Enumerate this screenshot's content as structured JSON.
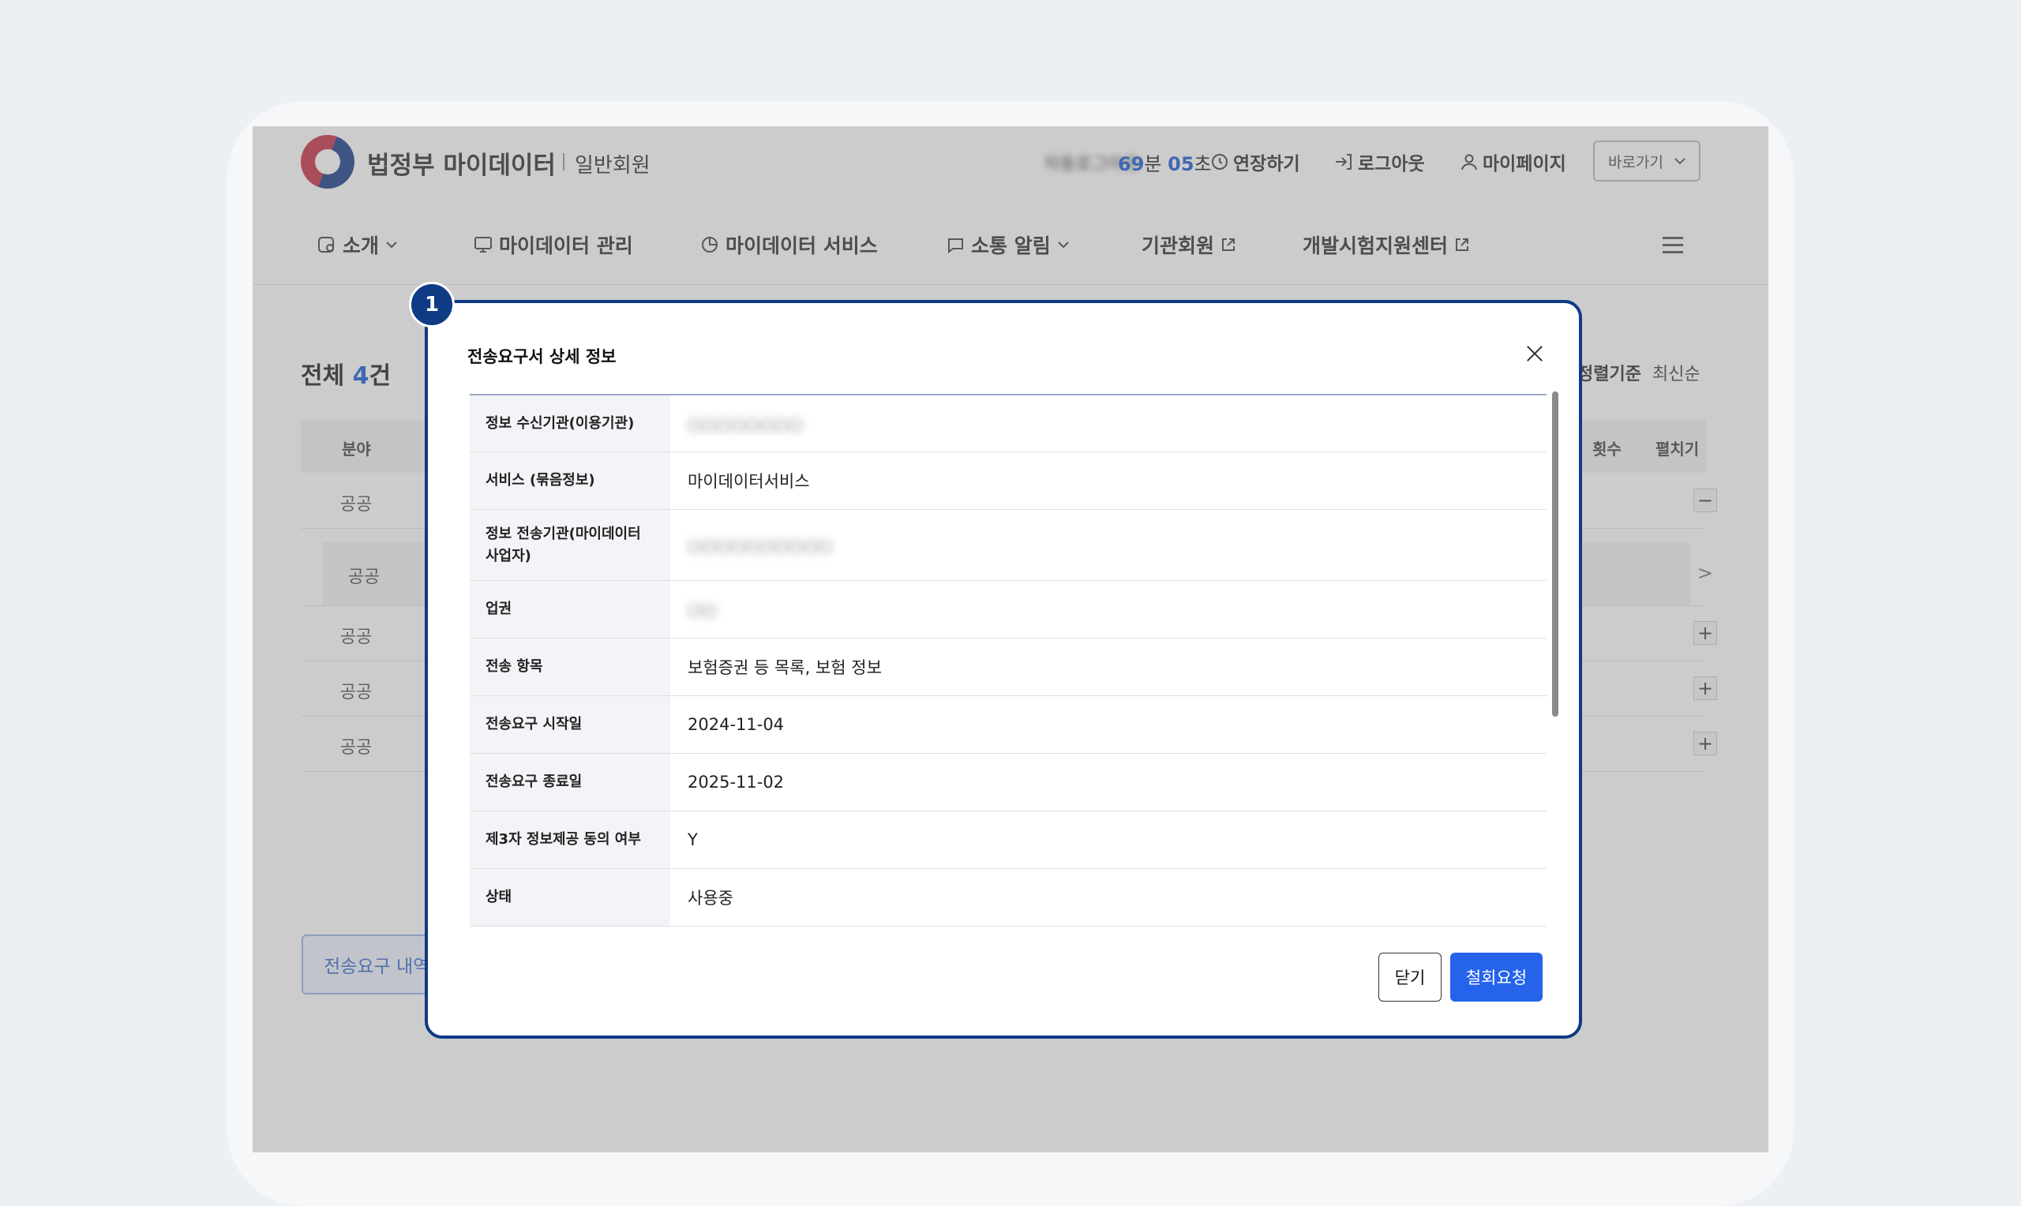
{
  "header": {
    "brand": "법정부 마이데이터",
    "member_type": "일반회원",
    "timer_label": "자동로그아웃",
    "timer_min": "69",
    "timer_min_unit": "분",
    "timer_sec": "05",
    "timer_sec_unit": "초",
    "extend": "연장하기",
    "logout": "로그아웃",
    "mypage": "마이페이지",
    "quick_select": "바로가기"
  },
  "nav": {
    "items": [
      {
        "label": "소개"
      },
      {
        "label": "마이데이터 관리"
      },
      {
        "label": "마이데이터 서비스"
      },
      {
        "label": "소통 알림"
      },
      {
        "label": "기관회원"
      },
      {
        "label": "개발시험지원센터"
      }
    ]
  },
  "list": {
    "total_prefix": "전체",
    "total_count": "4",
    "total_suffix": "건",
    "sort_label": "정렬기준",
    "sort_value": "최신순",
    "col_field": "분야",
    "col_count": "횟수",
    "col_expand": "펼치기",
    "rows": [
      {
        "field": "공공",
        "toggle": "−"
      },
      {
        "field": "공공",
        "toggle": ">"
      },
      {
        "field": "공공",
        "toggle": "+"
      },
      {
        "field": "공공",
        "toggle": "+"
      },
      {
        "field": "공공",
        "toggle": "+"
      }
    ],
    "bottom_button": "전송요구 내역"
  },
  "modal": {
    "badge": "1",
    "title": "전송요구서 상세 정보",
    "rows": [
      {
        "key": "정보 수신기관(이용기관)",
        "value": "○○○○○○○○"
      },
      {
        "key": "서비스 (묶음정보)",
        "value": "마이데이터서비스"
      },
      {
        "key": "정보 전송기관(마이데이터 사업자)",
        "value": "○○○○○○○○○○"
      },
      {
        "key": "업권",
        "value": "○○"
      },
      {
        "key": "전송 항목",
        "value": "보험증권 등 목록, 보험 정보"
      },
      {
        "key": "전송요구 시작일",
        "value": "2024-11-04"
      },
      {
        "key": "전송요구 종료일",
        "value": "2025-11-02"
      },
      {
        "key": "제3자 정보제공 동의 여부",
        "value": "Y"
      },
      {
        "key": "상태",
        "value": "사용중"
      }
    ],
    "close_button": "닫기",
    "revoke_button": "철회요청"
  }
}
